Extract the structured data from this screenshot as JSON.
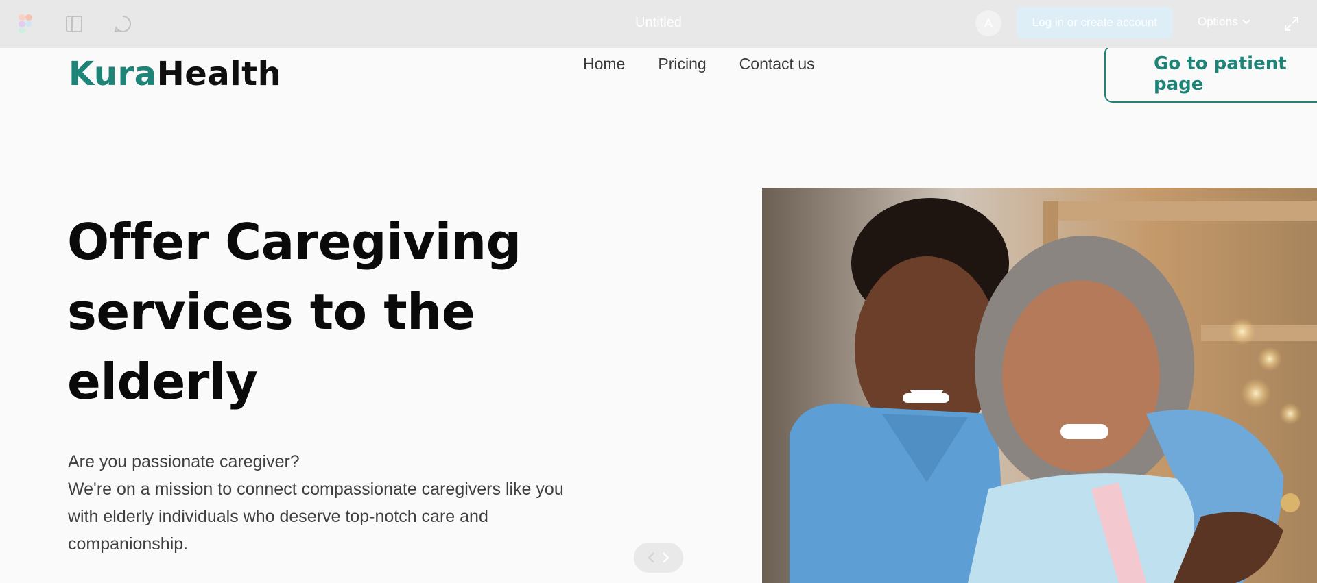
{
  "figma_bar": {
    "title": "Untitled",
    "avatar_initial": "A",
    "login_label": "Log in or create account",
    "options_label": "Options",
    "icons": [
      "figma-logo-icon",
      "sidebar-panel-icon",
      "comment-icon",
      "chevron-down-icon",
      "expand-icon"
    ]
  },
  "site": {
    "logo_primary": "Kura",
    "logo_secondary": "Health",
    "nav": [
      "Home",
      "Pricing",
      "Contact us"
    ],
    "cta_label": "Go to patient page"
  },
  "hero": {
    "title_lines": [
      "Offer Caregiving",
      "services to the",
      "elderly"
    ],
    "text_lines": [
      "Are you passionate caregiver?",
      "We're on a mission to connect compassionate caregivers like you",
      "with elderly individuals who deserve top-notch care and",
      "companionship."
    ]
  },
  "colors": {
    "brand_teal": "#1e8478",
    "scrub_blue": "#6fa9d9",
    "figma_bar": "#e8e8e8"
  }
}
